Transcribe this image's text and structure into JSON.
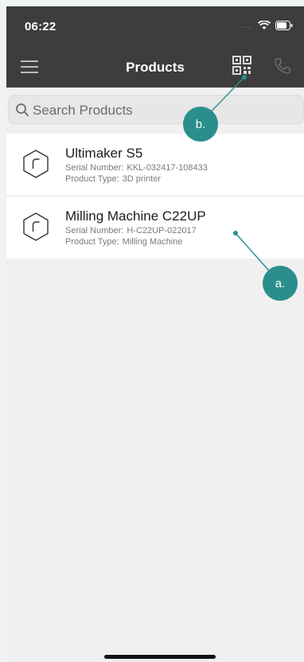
{
  "statusbar": {
    "time": "06:22",
    "signal": "....."
  },
  "navbar": {
    "title": "Products"
  },
  "search": {
    "placeholder": "Search Products"
  },
  "products": [
    {
      "name": "Ultimaker S5",
      "serial_label": "Serial Number:",
      "serial": "KKL-032417-108433",
      "type_label": "Product Type:",
      "type": "3D printer"
    },
    {
      "name": "Milling Machine C22UP",
      "serial_label": "Serial Number:",
      "serial": "H-C22UP-022017",
      "type_label": "Product Type:",
      "type": "Milling Machine"
    }
  ],
  "annotations": {
    "a": "a.",
    "b": "b."
  },
  "colors": {
    "bar": "#3d3d3d",
    "accent": "#2a8f8c",
    "background": "#f0f0f0"
  },
  "icons": [
    "menu-icon",
    "qr-code-icon",
    "phone-icon",
    "search-icon",
    "product-icon",
    "wifi-icon",
    "battery-icon"
  ]
}
